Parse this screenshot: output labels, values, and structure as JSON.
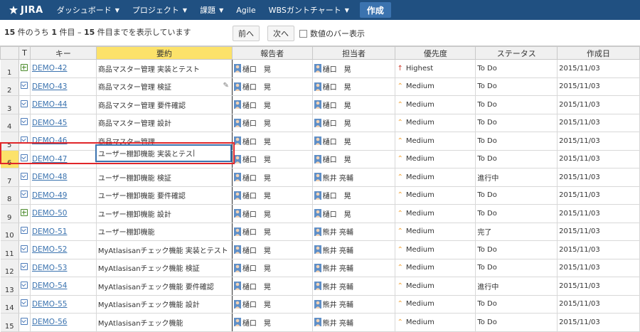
{
  "nav": {
    "logo": "JIRA",
    "items": [
      {
        "label": "ダッシュボード"
      },
      {
        "label": "プロジェクト"
      },
      {
        "label": "課題"
      },
      {
        "label": "Agile"
      },
      {
        "label": "WBSガントチャート"
      }
    ],
    "create_label": "作成"
  },
  "toolbar": {
    "pager_total": "15",
    "pager_mid1": " 件のうち ",
    "pager_start": "1",
    "pager_mid2": " 件目 – ",
    "pager_end": "15",
    "pager_suffix": " 件目までを表示しています",
    "prev_label": "前へ",
    "next_label": "次へ",
    "checkbox_label": "数値のバー表示"
  },
  "table": {
    "headers": {
      "type": "T",
      "key": "キー",
      "summary": "要約",
      "reporter": "報告者",
      "assignee": "担当者",
      "priority": "優先度",
      "status": "ステータス",
      "created": "作成日"
    },
    "selected_row": 6,
    "editing_value": "ユーザー棚卸機能 実装とテス",
    "rows": [
      {
        "num": "1",
        "type": "plus",
        "key": "DEMO-42",
        "summary": "商品マスター管理 実装とテスト",
        "reporter": "樋口　晃",
        "assignee": "樋口　晃",
        "priority": "Highest",
        "status": "To Do",
        "created": "2015/11/03"
      },
      {
        "num": "2",
        "type": "task",
        "key": "DEMO-43",
        "summary": "商品マスター管理 検証",
        "reporter": "樋口　晃",
        "assignee": "樋口　晃",
        "priority": "Medium",
        "status": "To Do",
        "created": "2015/11/03"
      },
      {
        "num": "3",
        "type": "task",
        "key": "DEMO-44",
        "summary": "商品マスター管理 要件確認",
        "reporter": "樋口　晃",
        "assignee": "樋口　晃",
        "priority": "Medium",
        "status": "To Do",
        "created": "2015/11/03"
      },
      {
        "num": "4",
        "type": "task",
        "key": "DEMO-45",
        "summary": "商品マスター管理 設計",
        "reporter": "樋口　晃",
        "assignee": "樋口　晃",
        "priority": "Medium",
        "status": "To Do",
        "created": "2015/11/03"
      },
      {
        "num": "5",
        "type": "task",
        "key": "DEMO-46",
        "summary": "商品マスター管理",
        "reporter": "樋口　晃",
        "assignee": "樋口　晃",
        "priority": "Medium",
        "status": "To Do",
        "created": "2015/11/03"
      },
      {
        "num": "6",
        "type": "task",
        "key": "DEMO-47",
        "summary": "",
        "reporter": "樋口　晃",
        "assignee": "樋口　晃",
        "priority": "Medium",
        "status": "To Do",
        "created": "2015/11/03"
      },
      {
        "num": "7",
        "type": "task",
        "key": "DEMO-48",
        "summary": "ユーザー棚卸機能 検証",
        "reporter": "樋口　晃",
        "assignee": "熊井 亮輔",
        "priority": "Medium",
        "status": "進行中",
        "created": "2015/11/03"
      },
      {
        "num": "8",
        "type": "task",
        "key": "DEMO-49",
        "summary": "ユーザー棚卸機能 要件確認",
        "reporter": "樋口　晃",
        "assignee": "樋口　晃",
        "priority": "Medium",
        "status": "To Do",
        "created": "2015/11/03"
      },
      {
        "num": "9",
        "type": "plus",
        "key": "DEMO-50",
        "summary": "ユーザー棚卸機能 設計",
        "reporter": "樋口　晃",
        "assignee": "樋口　晃",
        "priority": "Medium",
        "status": "To Do",
        "created": "2015/11/03"
      },
      {
        "num": "10",
        "type": "task",
        "key": "DEMO-51",
        "summary": "ユーザー棚卸機能",
        "reporter": "樋口　晃",
        "assignee": "熊井 亮輔",
        "priority": "Medium",
        "status": "完了",
        "created": "2015/11/03"
      },
      {
        "num": "11",
        "type": "task",
        "key": "DEMO-52",
        "summary": "MyAtlasisanチェック機能 実装とテスト",
        "reporter": "樋口　晃",
        "assignee": "熊井 亮輔",
        "priority": "Medium",
        "status": "To Do",
        "created": "2015/11/03"
      },
      {
        "num": "12",
        "type": "task",
        "key": "DEMO-53",
        "summary": "MyAtlasisanチェック機能 検証",
        "reporter": "樋口　晃",
        "assignee": "熊井 亮輔",
        "priority": "Medium",
        "status": "To Do",
        "created": "2015/11/03"
      },
      {
        "num": "13",
        "type": "task",
        "key": "DEMO-54",
        "summary": "MyAtlasisanチェック機能 要件確認",
        "reporter": "樋口　晃",
        "assignee": "熊井 亮輔",
        "priority": "Medium",
        "status": "進行中",
        "created": "2015/11/03"
      },
      {
        "num": "14",
        "type": "task",
        "key": "DEMO-55",
        "summary": "MyAtlasisanチェック機能 設計",
        "reporter": "樋口　晃",
        "assignee": "熊井 亮輔",
        "priority": "Medium",
        "status": "To Do",
        "created": "2015/11/03"
      },
      {
        "num": "15",
        "type": "task",
        "key": "DEMO-56",
        "summary": "MyAtlasisanチェック機能",
        "reporter": "樋口　晃",
        "assignee": "熊井 亮輔",
        "priority": "Medium",
        "status": "To Do",
        "created": "2015/11/03"
      }
    ]
  },
  "colors": {
    "nav_bg": "#205081",
    "create_bg": "#3b73af",
    "link": "#3b73af",
    "highest": "#d04437",
    "medium": "#f0a030",
    "selection": "#fce26a",
    "highlight_box": "#e0262a"
  },
  "icons": {
    "logo": "jira-logo-icon",
    "caret": "chevron-down-icon",
    "story": "add-subtask-icon",
    "task": "task-checkbox-icon",
    "avatar": "user-avatar-icon",
    "highest": "arrow-up-icon",
    "medium": "chevron-up-icon",
    "edit": "pencil-icon"
  }
}
